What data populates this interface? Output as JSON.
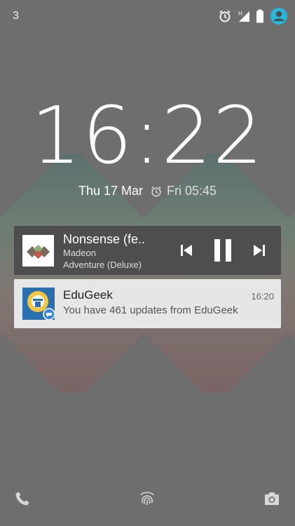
{
  "status_bar": {
    "notification_count": "3",
    "icons": [
      "alarm-icon",
      "signal-icon",
      "battery-icon",
      "user-avatar-icon"
    ],
    "accent": "#29b6d6"
  },
  "lockscreen": {
    "time": "16:22",
    "date": "Thu 17 Mar",
    "next_alarm": "Fri 05:45"
  },
  "media": {
    "title": "Nonsense (fe..",
    "artist": "Madeon",
    "album": "Adventure (Deluxe)",
    "controls": [
      "previous-icon",
      "pause-icon",
      "next-icon"
    ]
  },
  "notification": {
    "app": "EduGeek",
    "time": "16:20",
    "text": "You have 461 updates from EduGeek"
  },
  "bottom": {
    "icons": [
      "phone-icon",
      "fingerprint-icon",
      "camera-icon"
    ]
  },
  "colors": {
    "background": "#6e6e6e",
    "media_card": "#4e4e4e",
    "notification_card": "#e6e6e6"
  }
}
